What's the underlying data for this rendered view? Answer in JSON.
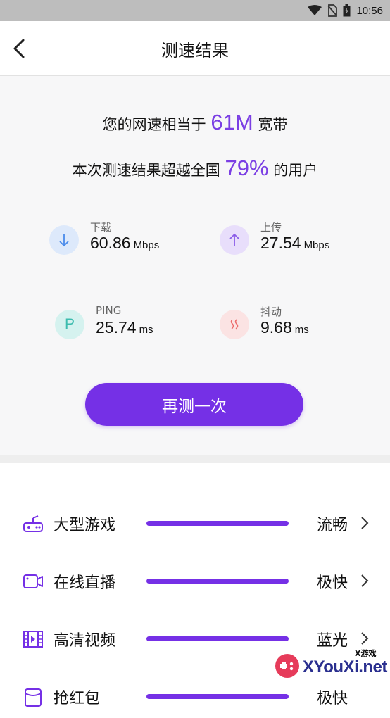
{
  "status_bar": {
    "time": "10:56",
    "icons": [
      "wifi-icon",
      "no-sim-icon",
      "battery-icon"
    ]
  },
  "header": {
    "title": "测速结果",
    "back_icon": "chevron-left-icon"
  },
  "summary": {
    "line1_prefix": "您的网速相当于",
    "line1_value": "61M",
    "line1_suffix": "宽带",
    "line2_prefix": "本次测速结果超越全国",
    "line2_value": "79%",
    "line2_suffix": "的用户"
  },
  "metrics": {
    "download": {
      "label": "下载",
      "value": "60.86",
      "unit": "Mbps",
      "icon": "arrow-down-icon"
    },
    "upload": {
      "label": "上传",
      "value": "27.54",
      "unit": "Mbps",
      "icon": "arrow-up-icon"
    },
    "ping": {
      "label": "PING",
      "value": "25.74",
      "unit": "ms",
      "icon_letter": "P"
    },
    "jitter": {
      "label": "抖动",
      "value": "9.68",
      "unit": "ms",
      "icon": "jitter-icon"
    }
  },
  "retest_label": "再测一次",
  "scenarios": [
    {
      "name": "大型游戏",
      "status": "流畅",
      "icon": "gamepad-icon",
      "level": 1.0
    },
    {
      "name": "在线直播",
      "status": "极快",
      "icon": "video-camera-icon",
      "level": 1.0
    },
    {
      "name": "高清视频",
      "status": "蓝光",
      "icon": "film-icon",
      "level": 1.0
    },
    {
      "name": "抢红包",
      "status": "极快",
      "icon": "red-packet-icon",
      "level": 1.0
    }
  ],
  "colors": {
    "accent": "#7530e6",
    "highlight": "#7b3fe4"
  },
  "watermark": {
    "text": "XYouXi.net",
    "small": "X游戏"
  }
}
